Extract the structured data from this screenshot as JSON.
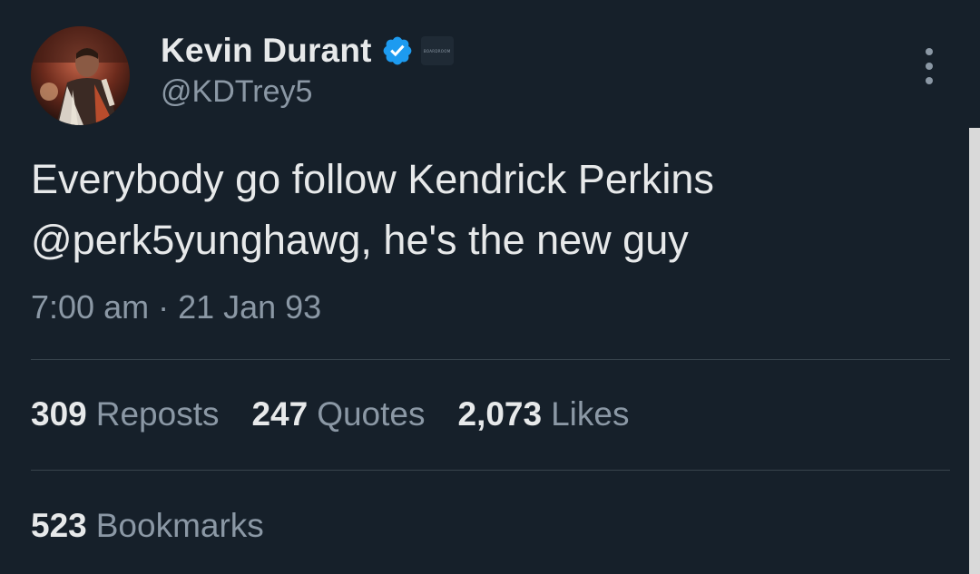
{
  "author": {
    "display_name": "Kevin Durant",
    "handle": "@KDTrey5",
    "verified": true,
    "affiliate_badge_text": "BOARDROOM"
  },
  "tweet": {
    "text_line1": "Everybody go follow Kendrick Perkins",
    "text_line2": "@perk5yunghawg, he's the new guy",
    "timestamp": "7:00 am · 21 Jan 93"
  },
  "stats": {
    "reposts_count": "309",
    "reposts_label": "Reposts",
    "quotes_count": "247",
    "quotes_label": "Quotes",
    "likes_count": "2,073",
    "likes_label": "Likes",
    "bookmarks_count": "523",
    "bookmarks_label": "Bookmarks"
  },
  "colors": {
    "background": "#16202a",
    "primary_text": "#e7e9ea",
    "secondary_text": "#8b98a5",
    "divider": "#38444d",
    "verified_badge": "#1d9bf0"
  },
  "icons": {
    "more": "more-vertical-icon",
    "verified": "verified-badge-icon"
  }
}
